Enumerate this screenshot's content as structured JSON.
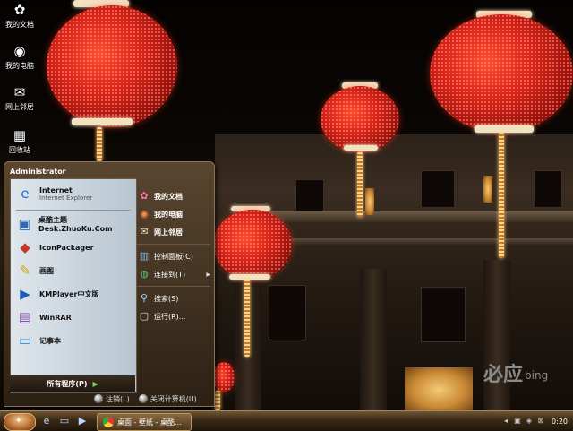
{
  "desktop": {
    "icons": [
      {
        "label": "我的文档",
        "icon": "my-documents-icon",
        "glyph": "✿"
      },
      {
        "label": "我的电脑",
        "icon": "my-computer-icon",
        "glyph": "◉"
      },
      {
        "label": "网上邻居",
        "icon": "network-icon",
        "glyph": "✉"
      },
      {
        "label": "回收站",
        "icon": "recycle-bin-icon",
        "glyph": "▦"
      }
    ],
    "watermark": {
      "brand": "必应",
      "brand_latin": "bing"
    }
  },
  "start_menu": {
    "user": "Administrator",
    "pinned": [
      {
        "title": "Internet",
        "subtitle": "Internet Explorer",
        "icon": "ie-icon",
        "glyph": "e"
      }
    ],
    "recent": [
      {
        "title": "桌酷主题Desk.ZhuoKu.Com",
        "icon": "zhuoku-icon",
        "glyph": "▣"
      },
      {
        "title": "IconPackager",
        "icon": "iconpackager-icon",
        "glyph": "◆"
      },
      {
        "title": "画图",
        "icon": "paint-icon",
        "glyph": "✎"
      },
      {
        "title": "KMPlayer中文版",
        "icon": "kmplayer-icon",
        "glyph": "▶"
      },
      {
        "title": "WinRAR",
        "icon": "winrar-icon",
        "glyph": "▤"
      },
      {
        "title": "记事本",
        "icon": "notepad-icon",
        "glyph": "▭"
      }
    ],
    "all_programs": "所有程序(P)",
    "places": [
      {
        "label": "我的文档",
        "icon": "my-documents-icon",
        "glyph": "✿",
        "bold": true
      },
      {
        "label": "我的电脑",
        "icon": "my-computer-icon",
        "glyph": "◉",
        "bold": true
      },
      {
        "label": "网上邻居",
        "icon": "network-icon",
        "glyph": "✉",
        "bold": true
      }
    ],
    "system": [
      {
        "label": "控制面板(C)",
        "icon": "control-panel-icon",
        "glyph": "▥",
        "submenu": false
      },
      {
        "label": "连接到(T)",
        "icon": "connect-icon",
        "glyph": "◍",
        "submenu": true
      }
    ],
    "tools": [
      {
        "label": "搜索(S)",
        "icon": "search-icon",
        "glyph": "⚲"
      },
      {
        "label": "运行(R)...",
        "icon": "run-icon",
        "glyph": "▢"
      }
    ],
    "logoff": "注销(L)",
    "shutdown": "关闭计算机(U)"
  },
  "taskbar": {
    "task_title": "桌面 - 壁纸 - 桌酷...",
    "clock": "0:20",
    "colors": {
      "accent": "#8a6a42"
    }
  }
}
